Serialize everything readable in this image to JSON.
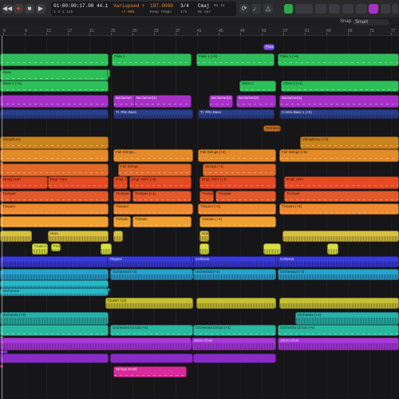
{
  "transport": {
    "time": "01:00:00:17.08",
    "bars": "1  3  1  125",
    "tempo_label": "44.1",
    "varispeed": "Varispeed +",
    "varispeed_value": "+7.00%",
    "bpm": "187.0000",
    "keep_tempo": "Keep Tempo",
    "signature": "3/4",
    "sig_sub": "1/4",
    "key": "Cmaj",
    "key_sub": "No Out",
    "in_label": "No In"
  },
  "toolbar": {
    "snap_label": "Snap:",
    "snap_value": "Smart"
  },
  "ruler": {
    "marks": [
      "5",
      "9",
      "13",
      "17",
      "21",
      "25",
      "29",
      "33",
      "37",
      "41",
      "45",
      "49",
      "53",
      "57",
      "61",
      "65",
      "69",
      "73",
      "77"
    ]
  },
  "regions": [
    {
      "name": "",
      "color": "#2fbf5a",
      "notes": true
    },
    {
      "name": "Flute 1",
      "color": "#2fbf5a",
      "notes": true
    },
    {
      "name": "Flute 1 (+5)",
      "color": "#2fbf5a",
      "notes": true
    },
    {
      "name": "Flute 1 (+6)",
      "color": "#2fbf5a",
      "notes": true
    },
    {
      "name": "Flute",
      "color": "#7a4fe0",
      "notes": false
    },
    {
      "name": "Oboe",
      "color": "#2fbf5a",
      "notes": true
    },
    {
      "name": "",
      "color": "#2fbf5a",
      "notes": true
    },
    {
      "name": "Oboe 1 (+5)",
      "color": "#2fbf5a",
      "notes": true
    },
    {
      "name": "Oboe 2",
      "color": "#2fbf5a",
      "notes": true
    },
    {
      "name": "Oboe 2 (+4)",
      "color": "#2fbf5a",
      "notes": true
    },
    {
      "name": "",
      "color": "#a830c8",
      "notes": true
    },
    {
      "name": "Bsclarinet",
      "color": "#a830c8",
      "notes": true
    },
    {
      "name": "Bsclarinet(1)",
      "color": "#a830c8",
      "notes": true
    },
    {
      "name": "Bsclarinet(2)",
      "color": "#a830c8",
      "notes": true
    },
    {
      "name": "Bsclarinet(3)",
      "color": "#a830c8",
      "notes": true
    },
    {
      "name": "Bsclarinet(4)",
      "color": "#a830c8",
      "notes": true
    },
    {
      "name": "",
      "color": "#2a3f8a",
      "notes": false
    },
    {
      "name": "Tr. Rhn Bass",
      "color": "#2a3f8a",
      "notes": false
    },
    {
      "name": "Tr. Rhn Bass",
      "color": "#2a3f8a",
      "notes": false
    },
    {
      "name": "Contra Bass 1 (+5)",
      "color": "#2a3f8a",
      "notes": false
    },
    {
      "name": "Orchestral",
      "color": "#c06a20",
      "notes": false
    },
    {
      "name": "Vibraphone",
      "color": "#c8821e",
      "notes": true
    },
    {
      "name": "Vibraphone (+5)",
      "color": "#c8821e",
      "notes": true
    },
    {
      "name": "",
      "color": "#e38a2a",
      "notes": true
    },
    {
      "name": "Full Strings...",
      "color": "#e38a2a",
      "notes": true
    },
    {
      "name": "Full Strings (+4)",
      "color": "#e38a2a",
      "notes": true
    },
    {
      "name": "Full Strings (+5)",
      "color": "#e38a2a",
      "notes": true
    },
    {
      "name": "Full Strings (+1)",
      "color": "#e38a2a",
      "notes": true
    },
    {
      "name": "",
      "color": "#e06a28",
      "notes": true
    },
    {
      "name": "Full Strings",
      "color": "#e06a28",
      "notes": true
    },
    {
      "name": "Strings (+1)",
      "color": "#e06a28",
      "notes": true
    },
    {
      "name": "String Horn",
      "color": "#e24a22",
      "notes": true
    },
    {
      "name": "Engl. Horn",
      "color": "#e24a22",
      "notes": true
    },
    {
      "name": "Engl. Ho",
      "color": "#e24a22",
      "notes": true
    },
    {
      "name": "Engl. Horn (+5)",
      "color": "#e24a22",
      "notes": true
    },
    {
      "name": "Engl. Horn (+4)",
      "color": "#e24a22",
      "notes": true
    },
    {
      "name": "Engl. Horn",
      "color": "#e24a22",
      "notes": true
    },
    {
      "name": "Trumpet",
      "color": "#e25a2a",
      "notes": true
    },
    {
      "name": "Trumpet",
      "color": "#e25a2a",
      "notes": true
    },
    {
      "name": "Trumpet (+1)",
      "color": "#e25a2a",
      "notes": true
    },
    {
      "name": "Trumpet (+5)",
      "color": "#e25a2a",
      "notes": true
    },
    {
      "name": "Trumpet",
      "color": "#e25a2a",
      "notes": true
    },
    {
      "name": "Trumpet",
      "color": "#e25a2a",
      "notes": true
    },
    {
      "name": "Timpani",
      "color": "#f08a30",
      "notes": true
    },
    {
      "name": "Timpani",
      "color": "#f08a30",
      "notes": true
    },
    {
      "name": "Timpani (+5)",
      "color": "#f08a30",
      "notes": true
    },
    {
      "name": "Timpani (+5)",
      "color": "#f08a30",
      "notes": true
    },
    {
      "name": "",
      "color": "#f0a032",
      "notes": true
    },
    {
      "name": "Timbale",
      "color": "#f0a032",
      "notes": true
    },
    {
      "name": "Timbale",
      "color": "#f0a032",
      "notes": true
    },
    {
      "name": "Timbale (+4)",
      "color": "#f0a032",
      "notes": true
    },
    {
      "name": "",
      "color": "#d8c040",
      "notes": false
    },
    {
      "name": "Horn",
      "color": "#d8c040",
      "notes": false
    },
    {
      "name": "",
      "color": "#d8c040",
      "notes": false
    },
    {
      "name": "Horn (+4)",
      "color": "#d8c040",
      "notes": false
    },
    {
      "name": "",
      "color": "#d8c040",
      "notes": false
    },
    {
      "name": "Frost (+1)",
      "color": "#d8e040",
      "notes": false
    },
    {
      "name": "Frost Out",
      "color": "#d8e040",
      "notes": false
    },
    {
      "name": "",
      "color": "#d8e040",
      "notes": false
    },
    {
      "name": "",
      "color": "#d8e040",
      "notes": false
    },
    {
      "name": "",
      "color": "#d8e040",
      "notes": false
    },
    {
      "name": "",
      "color": "#d8e040",
      "notes": false
    },
    {
      "name": "",
      "color": "#3a3ad8",
      "notes": false
    },
    {
      "name": "Timpani",
      "color": "#3a3ad8",
      "notes": false
    },
    {
      "name": "Cellosus",
      "color": "#3a3ad8",
      "notes": false
    },
    {
      "name": "Cellosus",
      "color": "#3a3ad8",
      "notes": false
    },
    {
      "name": "",
      "color": "#2aa0d0",
      "notes": false
    },
    {
      "name": "Orchestral (+2)",
      "color": "#2aa0d0",
      "notes": false
    },
    {
      "name": "Orchestral (+4)",
      "color": "#2aa0d0",
      "notes": false
    },
    {
      "name": "Orchestral (+1)",
      "color": "#2aa0d0",
      "notes": false
    },
    {
      "name": "",
      "color": "#28b8c8",
      "notes": false
    },
    {
      "name": "Orchestral",
      "color": "#28b8c8",
      "notes": false
    },
    {
      "name": "",
      "color": "#28b8c8",
      "notes": false
    },
    {
      "name": "Cluster 1(2)",
      "color": "#c8c030",
      "notes": false
    },
    {
      "name": "",
      "color": "#c8c030",
      "notes": false
    },
    {
      "name": "",
      "color": "#c8c030",
      "notes": false
    },
    {
      "name": "Orchestra (+4)",
      "color": "#2ab0a8",
      "notes": false
    },
    {
      "name": "Orchestra (+4)",
      "color": "#2ab0a8",
      "notes": false
    },
    {
      "name": "",
      "color": "#28b8a0",
      "notes": true
    },
    {
      "name": "Orchestral Circuit (+5)",
      "color": "#28b8a0",
      "notes": true
    },
    {
      "name": "Orchestral Circuit (+4)",
      "color": "#28b8a0",
      "notes": true
    },
    {
      "name": "Orchestra Circuit (+5)",
      "color": "#28b8a0",
      "notes": true
    },
    {
      "name": "Orchestral (+1)",
      "color": "#28b8a0",
      "notes": true
    },
    {
      "name": "",
      "color": "#a838d8",
      "notes": false
    },
    {
      "name": "Jazzo Choir",
      "color": "#a838d8",
      "notes": false
    },
    {
      "name": "Jazzo Choir",
      "color": "#a838d8",
      "notes": false
    },
    {
      "name": "Jazzo Choir",
      "color": "#a838d8",
      "notes": false
    },
    {
      "name": "",
      "color": "#8a2ac8",
      "notes": true
    },
    {
      "name": "",
      "color": "#8a2ac8",
      "notes": true
    },
    {
      "name": "",
      "color": "#8a2ac8",
      "notes": true
    },
    {
      "name": "",
      "color": "#8a2ac8",
      "notes": true
    },
    {
      "name": "Jazzo Choir",
      "color": "#8a2ac8",
      "notes": true
    },
    {
      "name": "Jazzo Choir",
      "color": "#8a2ac8",
      "notes": true
    },
    {
      "name": "Strings",
      "color": "#d82a9a",
      "notes": true
    },
    {
      "name": "Strings",
      "color": "#d82a9a",
      "notes": true
    },
    {
      "name": "Strings Small",
      "color": "#d82a9a",
      "notes": true
    }
  ]
}
